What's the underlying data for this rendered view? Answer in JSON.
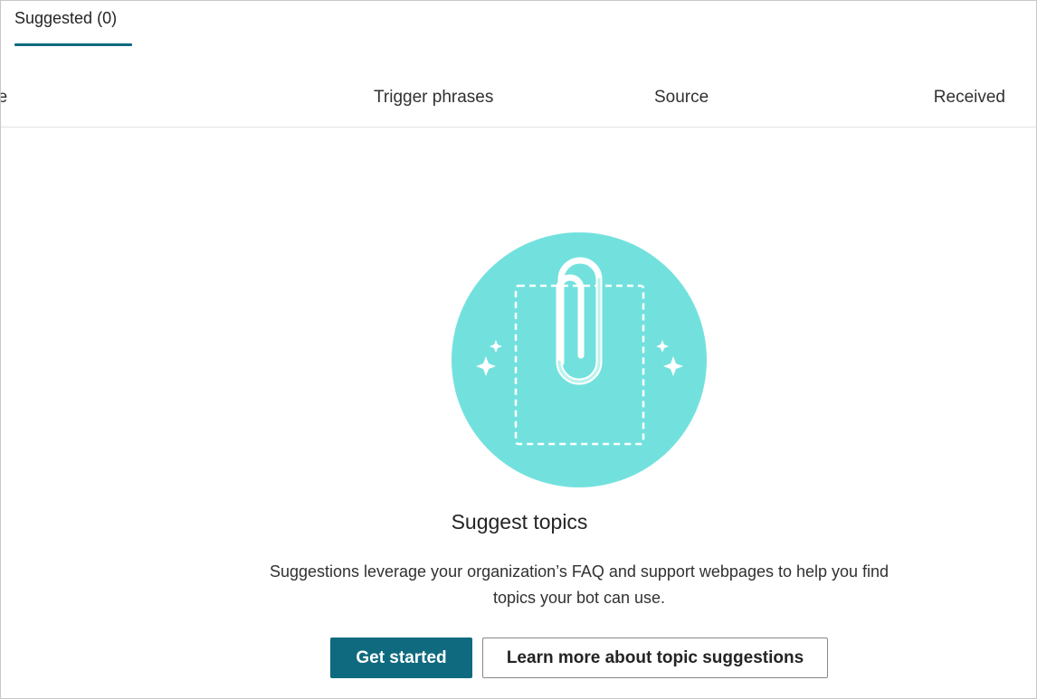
{
  "tabs": [
    {
      "label": "Suggested (0)",
      "selected": true
    }
  ],
  "table": {
    "columns": [
      {
        "label": "Name",
        "visible_text": "ne"
      },
      {
        "label": "Trigger phrases"
      },
      {
        "label": "Source"
      },
      {
        "label": "Received"
      }
    ]
  },
  "empty_state": {
    "illustration_icon": "paperclip-icon",
    "title": "Suggest topics",
    "description_line1": "Suggestions leverage your organization’s FAQ and support webpages to help you find",
    "description_line2": "topics your bot can use."
  },
  "actions": {
    "primary_label": "Get started",
    "secondary_label": "Learn more about topic suggestions"
  },
  "colors": {
    "accent": "#0f6a7f",
    "illustration_circle": "#72e1de",
    "border": "#c8c8c8"
  }
}
